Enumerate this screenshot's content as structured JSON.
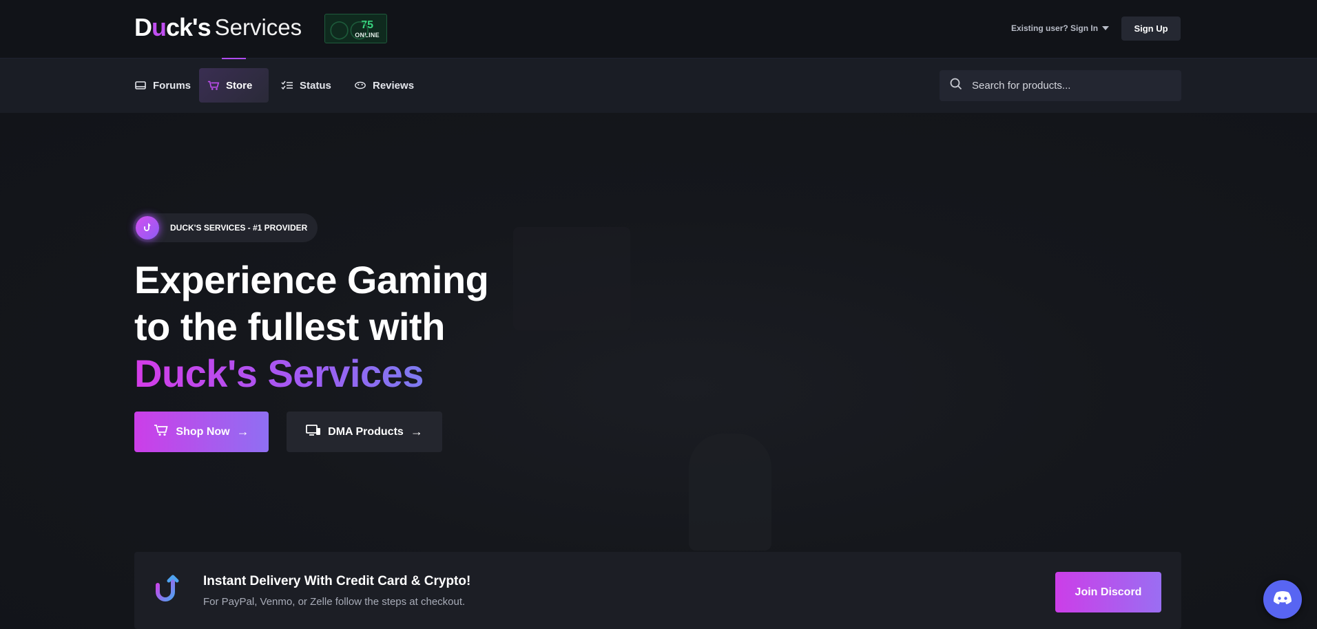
{
  "header": {
    "logo_main_prefix": "D",
    "logo_main_u": "u",
    "logo_main_suffix": "ck's",
    "logo_sub": "Services",
    "online_count": "75",
    "online_label": "ONLINE",
    "signin_label": "Existing user? Sign In",
    "signup_label": "Sign Up"
  },
  "nav": {
    "items": [
      {
        "label": "Forums",
        "icon": "forums-icon"
      },
      {
        "label": "Store",
        "icon": "cart-icon",
        "active": true
      },
      {
        "label": "Status",
        "icon": "checklist-icon"
      },
      {
        "label": "Reviews",
        "icon": "reviews-icon"
      }
    ],
    "search_placeholder": "Search for products..."
  },
  "hero": {
    "badge_text": "DUCK'S SERVICES - #1 PROVIDER",
    "headline_line1": "Experience Gaming",
    "headline_line2": "to the fullest with",
    "headline_highlight": "Duck's Services",
    "shop_button": "Shop Now",
    "dma_button": "DMA Products"
  },
  "promo": {
    "title": "Instant Delivery With Credit Card & Crypto!",
    "subtitle": "For PayPal, Venmo, or Zelle follow the steps at checkout.",
    "discord_button": "Join Discord"
  },
  "colors": {
    "accent_pink": "#cc3ee8",
    "accent_violet": "#8f6ff2",
    "discord_blue": "#5865f2",
    "online_green": "#38d47e"
  }
}
